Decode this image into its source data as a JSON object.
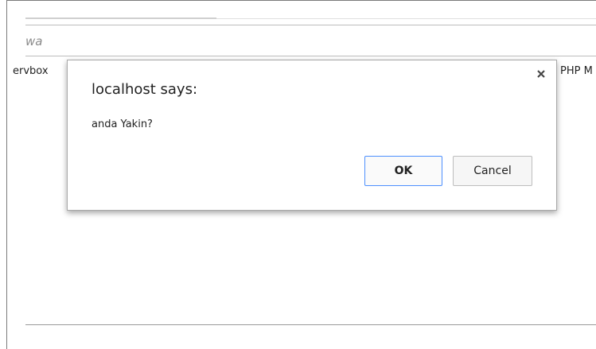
{
  "background": {
    "partial_input_text": "wa",
    "bookmark_left": "ervbox",
    "bookmark_right": "PHP M"
  },
  "dialog": {
    "title": "localhost says:",
    "message": "anda Yakin?",
    "close_icon": "close-icon",
    "ok_label": "OK",
    "cancel_label": "Cancel",
    "focus_color": "#4d90fe"
  }
}
